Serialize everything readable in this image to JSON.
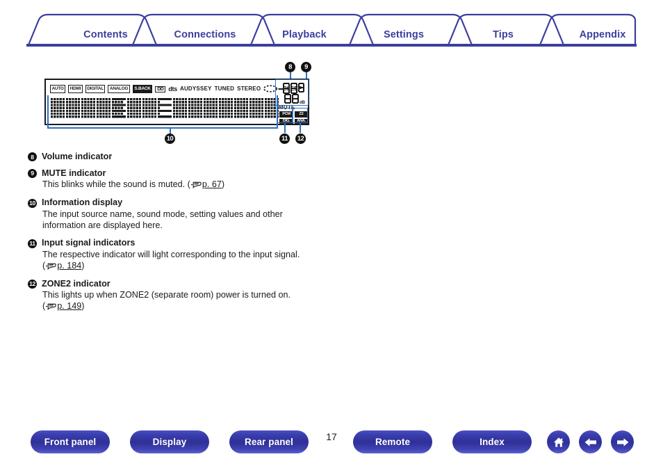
{
  "tabs": [
    {
      "label": "Contents"
    },
    {
      "label": "Connections"
    },
    {
      "label": "Playback"
    },
    {
      "label": "Settings"
    },
    {
      "label": "Tips"
    },
    {
      "label": "Appendix"
    }
  ],
  "figure": {
    "indicators": [
      {
        "text": "AUTO",
        "style": "box"
      },
      {
        "text": "HDMI",
        "style": "box"
      },
      {
        "text": "DIGITAL",
        "style": "box"
      },
      {
        "text": "ANALOG",
        "style": "box"
      },
      {
        "text": "S.BACK",
        "style": "filled"
      },
      {
        "text": "DD",
        "style": "dolby"
      },
      {
        "text": "dts",
        "style": "word-bold"
      },
      {
        "text": "AUDYSSEY",
        "style": "word"
      },
      {
        "text": "TUNED",
        "style": "word"
      },
      {
        "text": "STEREO",
        "style": "word"
      },
      {
        "text": "SLEEP",
        "style": "word-sleep"
      }
    ],
    "volume_value": "-00.0",
    "volume_unit": "dB",
    "mute_label": "MUTE",
    "signal_badges": [
      "PCM",
      "Z2",
      "DIG.",
      "ANA."
    ],
    "callouts": [
      "8",
      "9",
      "10",
      "11",
      "12"
    ]
  },
  "descriptions": [
    {
      "num": "8",
      "title": "Volume indicator",
      "body": "",
      "link": ""
    },
    {
      "num": "9",
      "title": "MUTE indicator",
      "body": "This blinks while the sound is muted.",
      "link": "p. 67"
    },
    {
      "num": "10",
      "title": "Information display",
      "body": "The input source name, sound mode, setting values and other information are displayed here.",
      "link": ""
    },
    {
      "num": "11",
      "title": "Input signal indicators",
      "body": "The respective indicator will light corresponding to the input signal.",
      "link": "p. 184"
    },
    {
      "num": "12",
      "title": "ZONE2 indicator",
      "body": "This lights up when ZONE2 (separate room) power is turned on.",
      "link": "p. 149"
    }
  ],
  "bottom_nav": {
    "buttons": [
      {
        "label": "Front panel"
      },
      {
        "label": "Display"
      },
      {
        "label": "Rear panel"
      },
      {
        "label": "Remote"
      },
      {
        "label": "Index"
      }
    ],
    "page_number": "17",
    "icons": [
      "home-icon",
      "arrow-left-icon",
      "arrow-right-icon"
    ]
  },
  "colors": {
    "brand": "#3b3f9e",
    "highlight": "#2f6fc4",
    "ink": "#1a1a1a"
  }
}
